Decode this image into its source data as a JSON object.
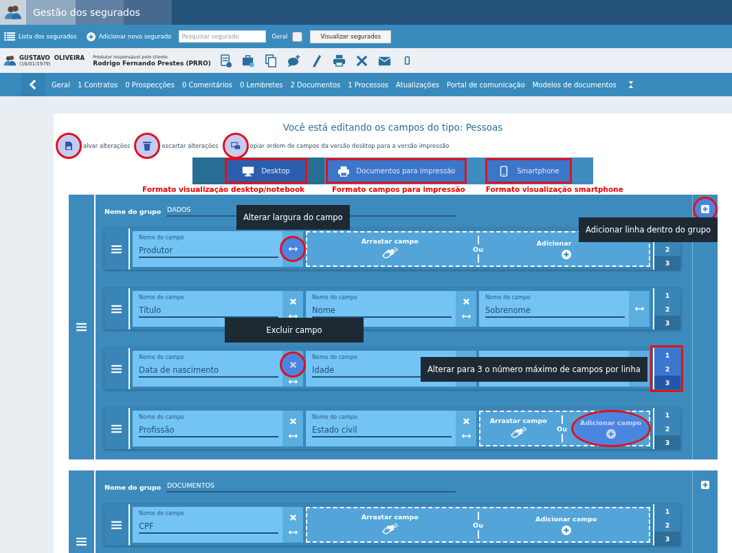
{
  "window": {
    "title": "Gestão dos segurados"
  },
  "toolbar": {
    "list_link": "Lista dos segurados",
    "add_link": "Adicionar novo segurado",
    "search": {
      "placeholder": "Pesquisar segurado"
    },
    "filter": {
      "label": "Geral",
      "checked": false
    },
    "view_button": "Visualizar segurados"
  },
  "client": {
    "name": "GUSTAVO  OLIVEIRA",
    "birth": "(16/01/1979)",
    "producer_caption": "Produtor responsável pelo cliente",
    "producer": "Rodrigo Fernando Prestes (PRRO)"
  },
  "nav": {
    "items": [
      "Geral",
      "1 Contratos",
      "0 Prospecções",
      "0 Comentários",
      "0 Lembretes",
      "2 Documentos",
      "1 Processos",
      "Atualizações",
      "Portal de comunicação",
      "Modelos de documentos"
    ]
  },
  "editor": {
    "heading": "Você está editando os campos do tipo: Pessoas",
    "actions": [
      {
        "kind": "save",
        "label": "alvar alterações",
        "annotated": true
      },
      {
        "kind": "discard",
        "label": "escartar alterações",
        "annotated": true
      },
      {
        "kind": "copy",
        "label": "opiar ordem de campos da versão desktop para a versão impressão",
        "annotated": true
      }
    ],
    "modes": [
      {
        "kind": "desktop",
        "label": "Desktop",
        "selected": true,
        "annotated": true,
        "caption": "Formato visualização desktop/notebook"
      },
      {
        "kind": "print",
        "label": "Documentos para impressão",
        "selected": false,
        "annotated": true,
        "caption": "Formato campos para impressão"
      },
      {
        "kind": "phone",
        "label": "Smartphone",
        "selected": false,
        "annotated": true,
        "caption": "Formato visualização smartphone"
      }
    ],
    "groups": [
      {
        "name_label": "Nome do grupo",
        "name": "DADOS",
        "add_row_annotated": true,
        "rows": [
          {
            "max_annotated": false,
            "max_options": [
              {
                "label": "2",
                "selected": false
              },
              {
                "label": "3",
                "selected": true
              }
            ],
            "items": [
              {
                "kind": "field",
                "label": "Nome do campo",
                "value": "Produtor",
                "removable": false,
                "resize_annotated": true
              },
              {
                "kind": "drop_zone",
                "drag_label": "Arrastar campo",
                "or_label": "Ou",
                "add_label": "Adicionar",
                "highlighted": false
              }
            ]
          },
          {
            "max_annotated": false,
            "max_options": [
              {
                "label": "1",
                "selected": false
              },
              {
                "label": "2",
                "selected": false
              },
              {
                "label": "3",
                "selected": true
              }
            ],
            "items": [
              {
                "kind": "field",
                "label": "Nome do campo",
                "value": "Título",
                "removable": true,
                "remove_annotated": false,
                "resize_annotated": false
              },
              {
                "kind": "field",
                "label": "Nome do campo",
                "value": "Nome",
                "removable": true,
                "remove_annotated": false,
                "resize_annotated": false
              },
              {
                "kind": "field",
                "label": "Nome do campo",
                "value": "Sobrenome",
                "removable": false,
                "resize_annotated": false
              }
            ]
          },
          {
            "max_annotated": true,
            "max_options": [
              {
                "label": "1",
                "selected": false
              },
              {
                "label": "2",
                "selected": false
              },
              {
                "label": "3",
                "selected": true
              }
            ],
            "items": [
              {
                "kind": "field",
                "label": "Nome do campo",
                "value": "Data de nascimento",
                "removable": true,
                "remove_annotated": true,
                "resize_annotated": false
              },
              {
                "kind": "field",
                "label": "Nome do campo",
                "value": "Idade"
              },
              {
                "kind": "field"
              }
            ]
          },
          {
            "max_annotated": false,
            "max_options": [
              {
                "label": "1",
                "selected": false
              },
              {
                "label": "2",
                "selected": false
              },
              {
                "label": "3",
                "selected": true
              }
            ],
            "items": [
              {
                "kind": "field",
                "label": "Nome do campo",
                "value": "Profissão",
                "removable": true,
                "remove_annotated": false,
                "resize_annotated": false
              },
              {
                "kind": "field",
                "label": "Nome do campo",
                "value": "Estado civil",
                "removable": true,
                "remove_annotated": false,
                "resize_annotated": false
              },
              {
                "kind": "drop_zone",
                "drag_label": "Arrastar campo",
                "or_label": "Ou",
                "add_label": "Adicionar campo",
                "highlighted": true
              }
            ]
          }
        ]
      },
      {
        "name_label": "Nome do grupo",
        "name": "DOCUMENTOS",
        "add_row_annotated": false,
        "rows": [
          {
            "max_annotated": false,
            "max_options": [
              {
                "label": "1",
                "selected": false
              },
              {
                "label": "2",
                "selected": false
              },
              {
                "label": "3",
                "selected": true
              }
            ],
            "items": [
              {
                "kind": "field",
                "label": "Nome do campo",
                "value": "CPF",
                "removable": true,
                "remove_annotated": false,
                "resize_annotated": false
              },
              {
                "kind": "drop_zone",
                "drag_label": "Arrastar campo",
                "or_label": "Ou",
                "add_label": "Adicionar campo",
                "highlighted": false
              }
            ]
          }
        ]
      }
    ]
  },
  "tooltips": [
    {
      "text": "Alterar largura do campo"
    },
    {
      "text": "Adicionar linha dentro do grupo"
    },
    {
      "text": "Excluir campo"
    },
    {
      "text": "Alterar para 3 o número máximo de campos por linha"
    }
  ]
}
